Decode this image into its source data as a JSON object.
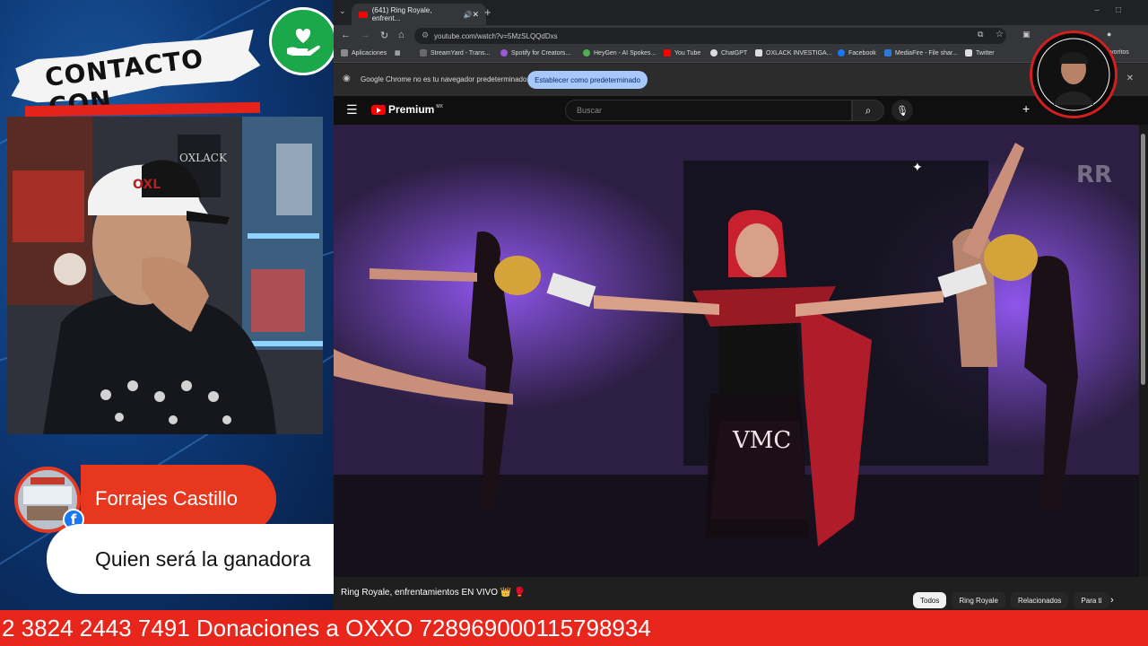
{
  "overlay": {
    "contact_label": "CONTACTO CON",
    "ticker_text": "2 3824 2443 7491 Donaciones a OXXO 728969000115798934",
    "colors": {
      "accent_red": "#e8261c",
      "green_badge": "#1aa84a",
      "bg_blue": "#0d3876"
    }
  },
  "webcam": {
    "cap_text": "OXL",
    "wall_text": "OXLACK"
  },
  "chat": {
    "author": "Forrajes Castillo",
    "message": "Quien será la ganadora",
    "platform_icon": "facebook-icon"
  },
  "browser": {
    "tab_title": "(641) Ring Royale, enfrent...",
    "url": "youtube.com/watch?v=5MzSLQQdDxs",
    "bookmarks": [
      {
        "label": "Aplicaciones",
        "color": "#8a8a8a"
      },
      {
        "label": "StreamYard - Trans...",
        "color": "#6a6a6a"
      },
      {
        "label": "Spotify for Creators...",
        "color": "#9b59d6"
      },
      {
        "label": "HeyGen - AI Spokes...",
        "color": "#4caf50"
      },
      {
        "label": "You Tube",
        "color": "#ff0000"
      },
      {
        "label": "ChatGPT",
        "color": "#dddddd"
      },
      {
        "label": "OXLACK INVESTIGA...",
        "color": "#dddddd"
      },
      {
        "label": "Facebook",
        "color": "#1877f2"
      },
      {
        "label": "MediaFire - File shar...",
        "color": "#2b7bd6"
      },
      {
        "label": "Twitter",
        "color": "#dddddd"
      },
      {
        "label": "Favoritos",
        "color": "#dddddd"
      }
    ],
    "infobar_message": "Google Chrome no es tu navegador predeterminado",
    "infobar_button": "Establecer como predeterminado"
  },
  "youtube": {
    "logo_text": "Premium",
    "region": "MX",
    "search_placeholder": "Buscar",
    "video_title": "Ring Royale, enfrentamientos EN VIVO 👑 🥊",
    "chips": [
      "Todos",
      "Ring Royale",
      "Relacionados",
      "Para ti"
    ],
    "watermark": "RR",
    "shorts_text": "VMC"
  }
}
